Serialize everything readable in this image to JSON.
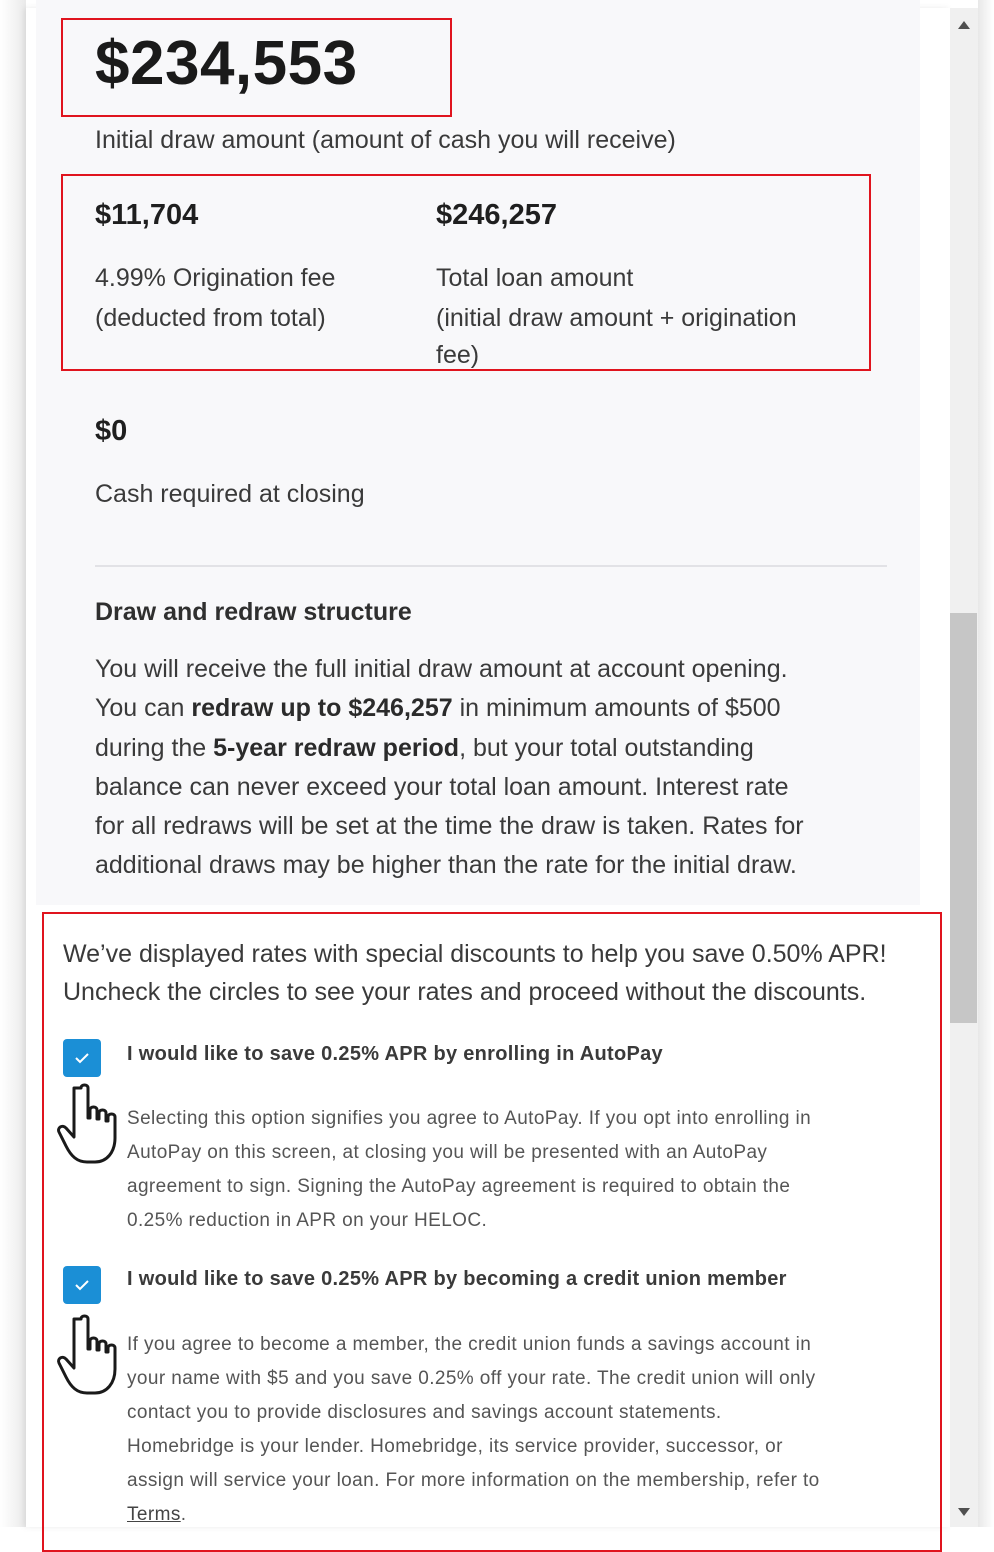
{
  "summary": {
    "initial_draw_amount": "$234,553",
    "initial_draw_label": "Initial draw amount (amount of cash you will receive)",
    "origination_fee_amount": "$11,704",
    "origination_fee_label_line1": "4.99% Origination fee",
    "origination_fee_label_line2": "(deducted from total)",
    "total_loan_amount": "$246,257",
    "total_loan_label_line1": "Total loan amount",
    "total_loan_label_line2": "(initial draw amount + origination",
    "total_loan_label_line3": "fee)",
    "cash_required_amount": "$0",
    "cash_required_label": "Cash required at closing"
  },
  "draw_structure": {
    "title": "Draw and redraw structure",
    "line1": "You will receive the full initial draw amount at account opening.",
    "line2_pre": "You can ",
    "line2_bold": "redraw up to $246,257",
    "line2_post": " in minimum amounts of $500",
    "line3_pre": "during the ",
    "line3_bold": "5-year redraw period",
    "line3_post": ", but your total outstanding",
    "line4": "balance can never exceed your total loan amount. Interest rate",
    "line5": "for all redraws will be set at the time the draw is taken. Rates for",
    "line6": "additional draws may be higher than the rate for the initial draw."
  },
  "discounts": {
    "intro_line1": "We’ve displayed rates with special discounts to help you save 0.50% APR!",
    "intro_line2": "Uncheck the circles to see your rates and proceed without the discounts.",
    "autopay": {
      "checked": true,
      "label": "I would like to save 0.25% APR by enrolling in AutoPay",
      "desc_line1": "Selecting this option signifies you agree to AutoPay. If you opt into enrolling in",
      "desc_line2": "AutoPay on this screen, at closing you will be presented with an AutoPay",
      "desc_line3": "agreement to sign. Signing the AutoPay agreement is required to obtain the",
      "desc_line4": "0.25% reduction in APR on your HELOC."
    },
    "membership": {
      "checked": true,
      "label": "I would like to save 0.25% APR by becoming a credit union member",
      "desc_line1": "If you agree to become a member, the credit union funds a savings account in",
      "desc_line2": "your name with $5 and you save 0.25% off your rate. The credit union will only",
      "desc_line3": "contact you to provide disclosures and savings account statements.",
      "desc_line4": "Homebridge is your lender. Homebridge, its service provider, successor, or",
      "desc_line5": "assign will service your loan. For more information on the membership, refer to",
      "terms_link": "Terms",
      "terms_suffix": "."
    }
  },
  "colors": {
    "highlight": "#e0141e",
    "checkbox": "#1b8fd6"
  }
}
